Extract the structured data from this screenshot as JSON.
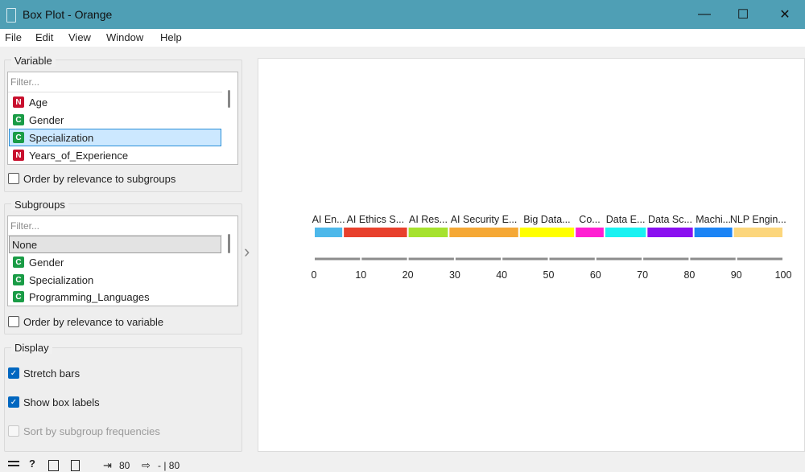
{
  "window": {
    "title": "Box Plot - Orange",
    "minimize": "—",
    "maximize": "☐",
    "close": "✕"
  },
  "menu": [
    "File",
    "Edit",
    "View",
    "Window",
    "Help"
  ],
  "variable": {
    "title": "Variable",
    "filter_placeholder": "Filter...",
    "items": [
      {
        "type": "N",
        "label": "Age",
        "color": "#c8102e"
      },
      {
        "type": "C",
        "label": "Gender",
        "color": "#1a9c46"
      },
      {
        "type": "C",
        "label": "Specialization",
        "color": "#1a9c46",
        "selected": true
      },
      {
        "type": "N",
        "label": "Years_of_Experience",
        "color": "#c8102e"
      }
    ],
    "order_label": "Order by relevance to subgroups"
  },
  "subgroups": {
    "title": "Subgroups",
    "filter_placeholder": "Filter...",
    "items": [
      {
        "type": "",
        "label": "None",
        "selected": true
      },
      {
        "type": "C",
        "label": "Gender",
        "color": "#1a9c46"
      },
      {
        "type": "C",
        "label": "Specialization",
        "color": "#1a9c46"
      },
      {
        "type": "C",
        "label": "Programming_Languages",
        "color": "#1a9c46"
      }
    ],
    "order_label": "Order by relevance to variable"
  },
  "display": {
    "title": "Display",
    "stretch_bars": "Stretch bars",
    "show_box_labels": "Show box labels",
    "sort_by_freq": "Sort by subgroup frequencies"
  },
  "collapse_arrow": "›",
  "chart_data": {
    "type": "bar",
    "orientation": "stretched-horizontal",
    "segments": [
      {
        "label": "AI En...",
        "start": 0,
        "end": 6.2,
        "color": "#4db8ea"
      },
      {
        "label": "AI Ethics S...",
        "start": 6.2,
        "end": 20.0,
        "color": "#e8402c"
      },
      {
        "label": "AI Res...",
        "start": 20.0,
        "end": 28.7,
        "color": "#a6e22e"
      },
      {
        "label": "AI Security E...",
        "start": 28.7,
        "end": 43.7,
        "color": "#f5a835"
      },
      {
        "label": "Big Data...",
        "start": 43.7,
        "end": 55.6,
        "color": "#ffff00"
      },
      {
        "label": "Co...",
        "start": 55.6,
        "end": 61.9,
        "color": "#ff1fd2"
      },
      {
        "label": "Data E...",
        "start": 61.9,
        "end": 70.9,
        "color": "#19f2f2"
      },
      {
        "label": "Data Sc...",
        "start": 70.9,
        "end": 80.9,
        "color": "#8a10f0"
      },
      {
        "label": "Machi...",
        "start": 80.9,
        "end": 89.3,
        "color": "#1b84f5"
      },
      {
        "label": "NLP Engin...",
        "start": 89.3,
        "end": 100.0,
        "color": "#fcd67c"
      }
    ],
    "ticks": [
      0,
      10,
      20,
      30,
      40,
      50,
      60,
      70,
      80,
      90,
      100
    ],
    "xlim": [
      0,
      100
    ]
  },
  "status": {
    "in_count": "80",
    "out_count": "- | 80"
  }
}
